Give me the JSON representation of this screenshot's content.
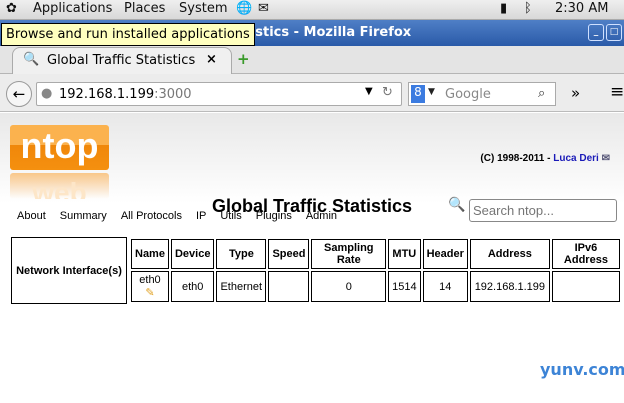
{
  "panel": {
    "applications": "Applications",
    "places": "Places",
    "system": "System",
    "clock": "2:30 AM"
  },
  "tooltip": "Browse and run installed applications",
  "window": {
    "title": "Global Traffic Statistics - Mozilla Firefox",
    "title_visible": "c Statistics - Mozilla Firefox"
  },
  "tab": {
    "label": "Global Traffic Statistics",
    "close": "×",
    "new": "+"
  },
  "nav": {
    "url_host": "192.168.1.199",
    "url_port": ":3000",
    "search_placeholder": "Google",
    "overflow": "»"
  },
  "page": {
    "logo": "ntop",
    "logo_reflection": "web",
    "copyright": "(C) 1998-2011 - ",
    "author": "Luca Deri",
    "menu": [
      "About",
      "Summary",
      "All Protocols",
      "IP",
      "Utils",
      "Plugins",
      "Admin"
    ],
    "search_placeholder": "Search ntop...",
    "title": "Global Traffic Statistics",
    "row_label": "Network Interface(s)",
    "headers": [
      "Name",
      "Device",
      "Type",
      "Speed",
      "Sampling Rate",
      "MTU",
      "Header",
      "Address",
      "IPv6 Address"
    ],
    "row": [
      "eth0",
      "eth0",
      "Ethernet",
      "",
      "0",
      "1514",
      "14",
      "192.168.1.199",
      ""
    ]
  },
  "watermark": "yunv.com"
}
